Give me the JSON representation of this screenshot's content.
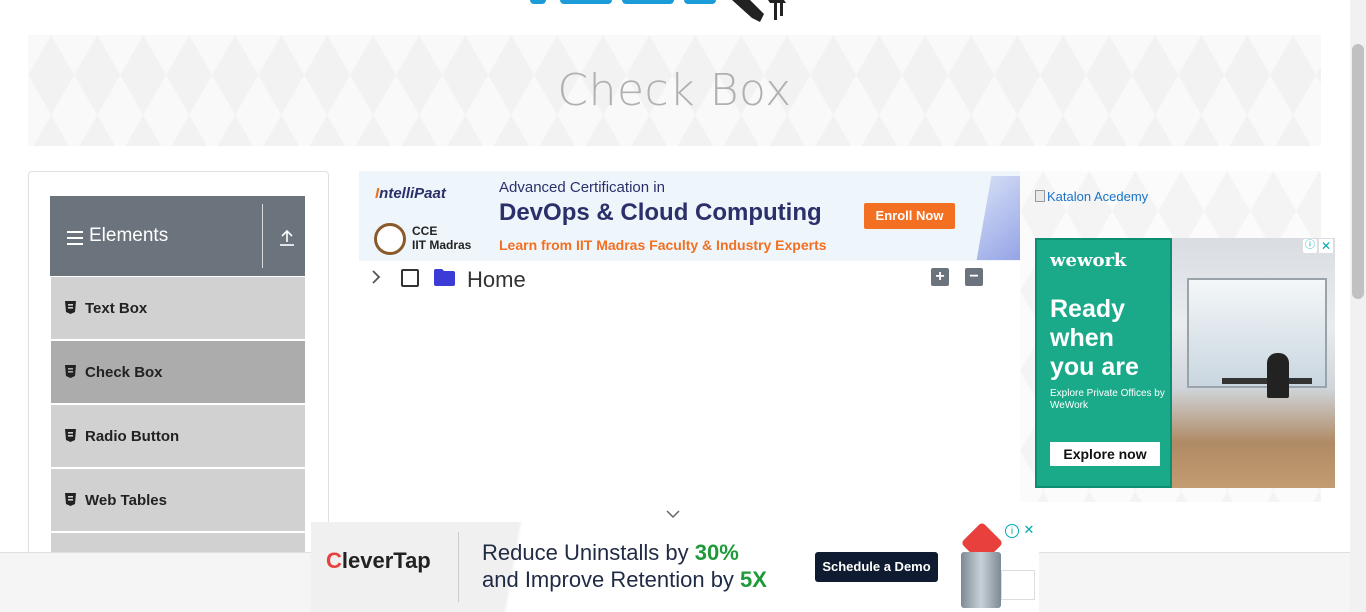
{
  "page": {
    "title": "Check Box"
  },
  "sidebar": {
    "group_title": "Elements",
    "items": [
      {
        "label": "Text Box"
      },
      {
        "label": "Check Box"
      },
      {
        "label": "Radio Button"
      },
      {
        "label": "Web Tables"
      },
      {
        "label": ""
      }
    ]
  },
  "tree": {
    "root_label": "Home",
    "expand_all_label": "+",
    "collapse_all_label": "−"
  },
  "ads": {
    "top": {
      "brand_prefix": "I",
      "brand_rest": "ntelliPaat",
      "partner_line1": "CCE",
      "partner_line2": "IIT Madras",
      "line1": "Advanced Certification in",
      "line2": "DevOps & Cloud Computing",
      "line3": "Learn from IIT Madras Faculty & Industry Experts",
      "cta": "Enroll Now"
    },
    "katalon_alt": "Katalon Acedemy",
    "right": {
      "brand": "wework",
      "headline": "Ready when you are",
      "sub": "Explore Private Offices by WeWork",
      "cta": "Explore now",
      "adchoice": "ⓘ",
      "close": "✕"
    },
    "bottom": {
      "brand_c": "C",
      "brand_rest": "leverTap",
      "line1_pre": "Reduce Uninstalls by ",
      "line1_hl": "30%",
      "line2_pre": "and Improve Retention by ",
      "line2_hl": "5X",
      "cta": "Schedule a Demo",
      "adchoice": "i",
      "close": "✕"
    }
  },
  "colors": {
    "nav_header": "#6b737d",
    "nav_item": "#d1d1d1",
    "nav_item_active": "#acacac",
    "folder": "#3b3bd6"
  }
}
